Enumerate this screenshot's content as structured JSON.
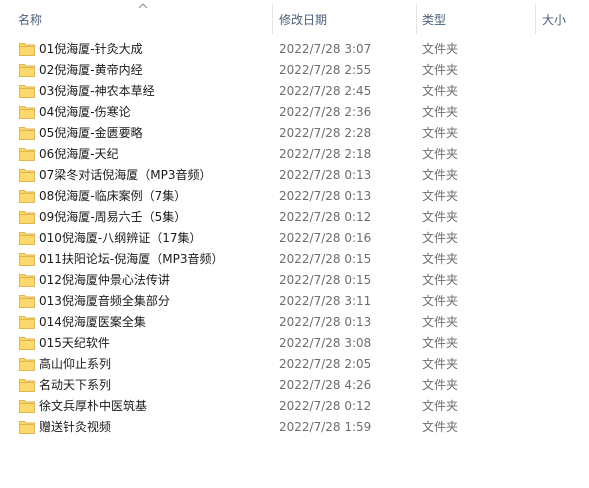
{
  "columns": {
    "name": "名称",
    "modified": "修改日期",
    "type": "类型",
    "size": "大小"
  },
  "icons": {
    "sort": "chevron-up-icon",
    "folder": "folder-icon"
  },
  "colors": {
    "folder_fill": "#F8D775",
    "folder_tab": "#E8B94A",
    "header_text": "#4C607A",
    "secondary_text": "#6D6D6D"
  },
  "files": [
    {
      "name": "01倪海厦-针灸大成",
      "modified": "2022/7/28 3:07",
      "type": "文件夹"
    },
    {
      "name": "02倪海厦-黄帝内经",
      "modified": "2022/7/28 2:55",
      "type": "文件夹"
    },
    {
      "name": "03倪海厦-神农本草经",
      "modified": "2022/7/28 2:45",
      "type": "文件夹"
    },
    {
      "name": "04倪海厦-伤寒论",
      "modified": "2022/7/28 2:36",
      "type": "文件夹"
    },
    {
      "name": "05倪海厦-金匮要略",
      "modified": "2022/7/28 2:28",
      "type": "文件夹"
    },
    {
      "name": "06倪海厦-天纪",
      "modified": "2022/7/28 2:18",
      "type": "文件夹"
    },
    {
      "name": "07梁冬对话倪海厦（MP3音频）",
      "modified": "2022/7/28 0:13",
      "type": "文件夹"
    },
    {
      "name": "08倪海厦-临床案例（7集）",
      "modified": "2022/7/28 0:13",
      "type": "文件夹"
    },
    {
      "name": "09倪海厦-周易六壬（5集）",
      "modified": "2022/7/28 0:12",
      "type": "文件夹"
    },
    {
      "name": "010倪海厦-八纲辨证（17集）",
      "modified": "2022/7/28 0:16",
      "type": "文件夹"
    },
    {
      "name": "011扶阳论坛-倪海厦（MP3音频）",
      "modified": "2022/7/28 0:15",
      "type": "文件夹"
    },
    {
      "name": "012倪海厦仲景心法传讲",
      "modified": "2022/7/28 0:15",
      "type": "文件夹"
    },
    {
      "name": "013倪海厦音频全集部分",
      "modified": "2022/7/28 3:11",
      "type": "文件夹"
    },
    {
      "name": "014倪海厦医案全集",
      "modified": "2022/7/28 0:13",
      "type": "文件夹"
    },
    {
      "name": "015天纪软件",
      "modified": "2022/7/28 3:08",
      "type": "文件夹"
    },
    {
      "name": "高山仰止系列",
      "modified": "2022/7/28 2:05",
      "type": "文件夹"
    },
    {
      "name": "名动天下系列",
      "modified": "2022/7/28 4:26",
      "type": "文件夹"
    },
    {
      "name": "徐文兵厚朴中医筑基",
      "modified": "2022/7/28 0:12",
      "type": "文件夹"
    },
    {
      "name": "赠送针灸视频",
      "modified": "2022/7/28 1:59",
      "type": "文件夹"
    }
  ]
}
